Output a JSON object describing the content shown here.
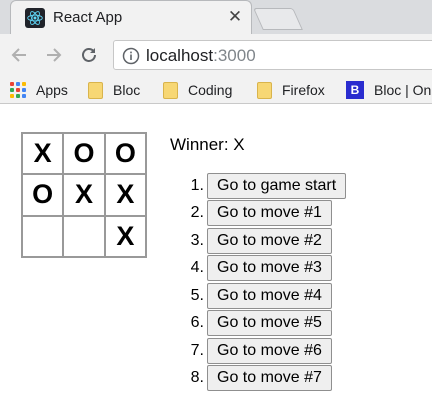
{
  "browser": {
    "tab": {
      "title": "React App",
      "close_glyph": "✕",
      "icon": "react-icon"
    },
    "address": {
      "host": "localhost",
      "port": ":3000",
      "icon": "info-icon"
    },
    "bookmarks": [
      {
        "label": "Apps",
        "icon": "apps-icon"
      },
      {
        "label": "Bloc",
        "icon": "folder-icon"
      },
      {
        "label": "Coding",
        "icon": "folder-icon"
      },
      {
        "label": "Firefox",
        "icon": "folder-icon"
      },
      {
        "label": "Bloc | On",
        "icon": "bloc-icon",
        "icon_text": "B"
      }
    ]
  },
  "game": {
    "board": [
      [
        "X",
        "O",
        "O"
      ],
      [
        "O",
        "X",
        "X"
      ],
      [
        "",
        "",
        "X"
      ]
    ],
    "status": "Winner: X",
    "moves": [
      {
        "num": "1.",
        "label": "Go to game start"
      },
      {
        "num": "2.",
        "label": "Go to move #1"
      },
      {
        "num": "3.",
        "label": "Go to move #2"
      },
      {
        "num": "4.",
        "label": "Go to move #3"
      },
      {
        "num": "5.",
        "label": "Go to move #4"
      },
      {
        "num": "6.",
        "label": "Go to move #5"
      },
      {
        "num": "7.",
        "label": "Go to move #6"
      },
      {
        "num": "8.",
        "label": "Go to move #7"
      }
    ]
  },
  "colors": {
    "react_blue": "#61dafb",
    "folder_yellow": "#f7d774",
    "bloc_blue": "#2a2ccf"
  }
}
